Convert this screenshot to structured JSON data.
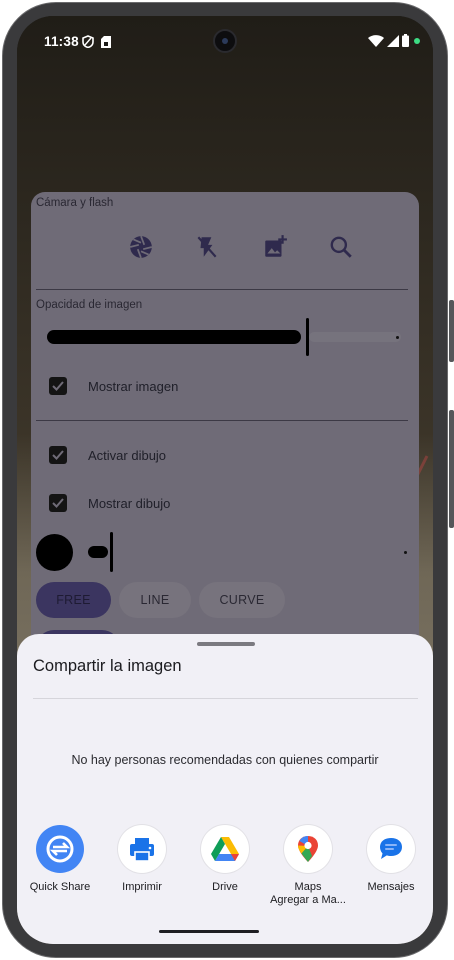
{
  "status_bar": {
    "time": "11:38"
  },
  "app": {
    "camera_section_title": "Cámara y flash",
    "opacity_section_title": "Opacidad de imagen",
    "opacity_value_fraction": 0.68,
    "show_image_label": "Mostrar imagen",
    "enable_drawing_label": "Activar dibujo",
    "show_drawing_label": "Mostrar dibujo",
    "modes": [
      "FREE",
      "LINE",
      "CURVE"
    ],
    "active_mode": "FREE",
    "icons": [
      "camera-shutter-icon",
      "flash-off-icon",
      "add-image-icon",
      "search-icon"
    ]
  },
  "share_sheet": {
    "title": "Compartir la imagen",
    "empty_message": "No hay personas recomendadas con quienes compartir",
    "targets": [
      {
        "label": "Quick Share",
        "sublabel": "",
        "icon": "quick-share-icon"
      },
      {
        "label": "Imprimir",
        "sublabel": "",
        "icon": "print-icon"
      },
      {
        "label": "Drive",
        "sublabel": "",
        "icon": "drive-icon"
      },
      {
        "label": "Maps",
        "sublabel": "Agregar a Ma...",
        "icon": "maps-icon"
      },
      {
        "label": "Mensajes",
        "sublabel": "",
        "icon": "messages-icon"
      }
    ]
  },
  "colors": {
    "accent": "#3b3560",
    "sheet_bg": "#f1f0f6",
    "quick_share_blue": "#4285f4"
  }
}
